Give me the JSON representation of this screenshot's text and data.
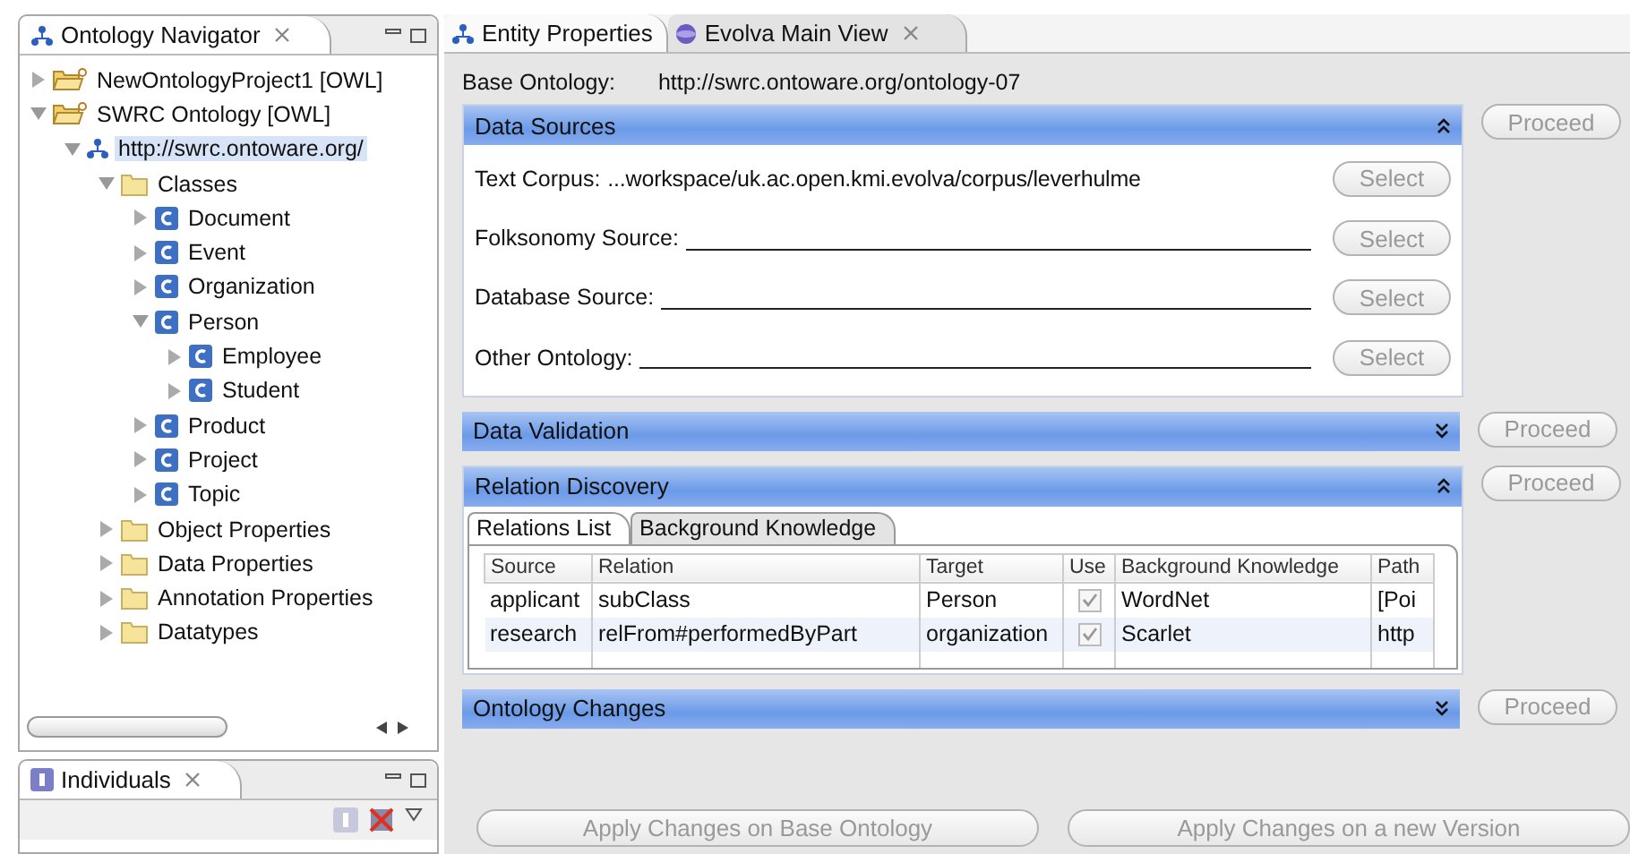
{
  "navigator": {
    "title": "Ontology Navigator",
    "tree": [
      {
        "kind": "project",
        "label": "NewOntologyProject1 [OWL]",
        "expanded": false,
        "selected": false
      },
      {
        "kind": "project",
        "label": "SWRC Ontology [OWL]",
        "expanded": true,
        "selected": false,
        "children": [
          {
            "kind": "ontology",
            "label": "http://swrc.ontoware.org/",
            "expanded": true,
            "selected": true,
            "children": [
              {
                "kind": "folder",
                "label": "Classes",
                "expanded": true,
                "selected": false,
                "children": [
                  {
                    "kind": "class",
                    "label": "Document",
                    "expanded": false,
                    "selected": false
                  },
                  {
                    "kind": "class",
                    "label": "Event",
                    "expanded": false,
                    "selected": false
                  },
                  {
                    "kind": "class",
                    "label": "Organization",
                    "expanded": false,
                    "selected": false
                  },
                  {
                    "kind": "class",
                    "label": "Person",
                    "expanded": true,
                    "selected": false,
                    "children": [
                      {
                        "kind": "class",
                        "label": "Employee",
                        "expanded": false,
                        "selected": false
                      },
                      {
                        "kind": "class",
                        "label": "Student",
                        "expanded": false,
                        "selected": false
                      }
                    ]
                  },
                  {
                    "kind": "class",
                    "label": "Product",
                    "expanded": false,
                    "selected": false
                  },
                  {
                    "kind": "class",
                    "label": "Project",
                    "expanded": false,
                    "selected": false
                  },
                  {
                    "kind": "class",
                    "label": "Topic",
                    "expanded": false,
                    "selected": false
                  }
                ]
              },
              {
                "kind": "folder",
                "label": "Object Properties",
                "expanded": false,
                "selected": false
              },
              {
                "kind": "folder",
                "label": "Data Properties",
                "expanded": false,
                "selected": false
              },
              {
                "kind": "folder",
                "label": "Annotation Properties",
                "expanded": false,
                "selected": false
              },
              {
                "kind": "folder",
                "label": "Datatypes",
                "expanded": false,
                "selected": false
              }
            ]
          }
        ]
      }
    ]
  },
  "individuals": {
    "title": "Individuals"
  },
  "editor_tabs": [
    {
      "label": "Entity Properties",
      "selected": false
    },
    {
      "label": "Evolva Main View",
      "selected": true
    }
  ],
  "base_ontology": {
    "label": "Base Ontology:",
    "value": "http://swrc.ontoware.org/ontology-07"
  },
  "sections": [
    {
      "kind": "sources",
      "title": "Data Sources",
      "expanded": true,
      "proceed": "Proceed",
      "rows": [
        {
          "label": "Text Corpus:",
          "value": "...workspace/uk.ac.open.kmi.evolva/corpus/leverhulme",
          "button": "Select"
        },
        {
          "label": "Folksonomy Source:",
          "button": "Select"
        },
        {
          "label": "Database Source:",
          "button": "Select"
        },
        {
          "label": "Other Ontology:",
          "button": "Select"
        }
      ]
    },
    {
      "title": "Data Validation",
      "expanded": false,
      "proceed": "Proceed"
    },
    {
      "kind": "relations",
      "title": "Relation Discovery",
      "expanded": true,
      "proceed": "Proceed",
      "tabs": [
        {
          "label": "Relations List",
          "selected": true
        },
        {
          "label": "Background Knowledge",
          "selected": false
        }
      ],
      "columns": [
        "Source",
        "Relation",
        "Target",
        "Use",
        "Background Knowledge",
        "Path"
      ],
      "rows": [
        {
          "source": "applicant",
          "relation": "subClass",
          "target": "Person",
          "use": true,
          "background": "WordNet",
          "path": "[Poi"
        },
        {
          "source": "research",
          "relation": "relFrom#performedByPart",
          "target": "organization",
          "use": true,
          "background": "Scarlet",
          "path": "http"
        }
      ]
    },
    {
      "title": "Ontology Changes",
      "expanded": false,
      "proceed": "Proceed"
    }
  ],
  "actions": [
    "Apply Changes on Base Ontology",
    "Apply Changes on a new Version"
  ]
}
